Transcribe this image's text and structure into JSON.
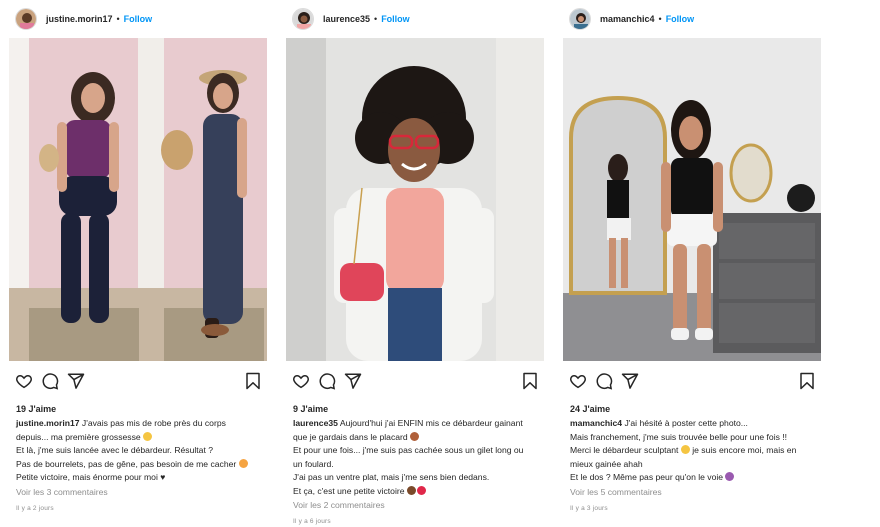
{
  "posts": [
    {
      "username": "justine.morin17",
      "follow_label": "Follow",
      "likes": "19 J'aime",
      "caption_user": "justine.morin17",
      "caption_lines": [
        "J'avais pas mis de robe près du corps",
        "depuis... ma première grossesse",
        "Et là, j'me suis lancée avec le débardeur. Résultat ?",
        "Pas de bourrelets, pas de gêne, pas besoin de me cacher",
        "Petite victoire, mais énorme pour moi ♥"
      ],
      "comments": "Voir les 3 commentaires",
      "time": "Il y a 2 jours"
    },
    {
      "username": "laurence35",
      "follow_label": "Follow",
      "likes": "9 J'aime",
      "caption_user": "laurence35",
      "caption_lines": [
        "Aujourd'hui j'ai ENFIN mis ce débardeur gainant",
        "que je gardais dans le placard",
        "Et pour une fois... j'me suis pas cachée sous un gilet long ou",
        "un foulard.",
        "J'ai pas un ventre plat, mais j'me sens bien dedans.",
        "Et ça, c'est une petite victoire"
      ],
      "comments": "Voir les 2 commentaires",
      "time": "Il y a 6 jours"
    },
    {
      "username": "mamanchic4",
      "follow_label": "Follow",
      "likes": "24 J'aime",
      "caption_user": "mamanchic4",
      "caption_lines": [
        "J'ai hésité à poster cette photo...",
        "Mais franchement, j'me suis trouvée belle pour une fois !!",
        "Merci le débardeur sculptant",
        "je suis encore moi, mais en",
        "mieux gainée ahah",
        "Et le dos ? Même pas peur qu'on le voie"
      ],
      "comments": "Voir les 5 commentaires",
      "time": "Il y a 3 jours"
    }
  ],
  "colors": {
    "accent": "#0095f6",
    "text": "#262626",
    "muted": "#8e8e8e"
  },
  "icons": [
    "heart-icon",
    "comment-icon",
    "share-icon",
    "bookmark-icon"
  ]
}
